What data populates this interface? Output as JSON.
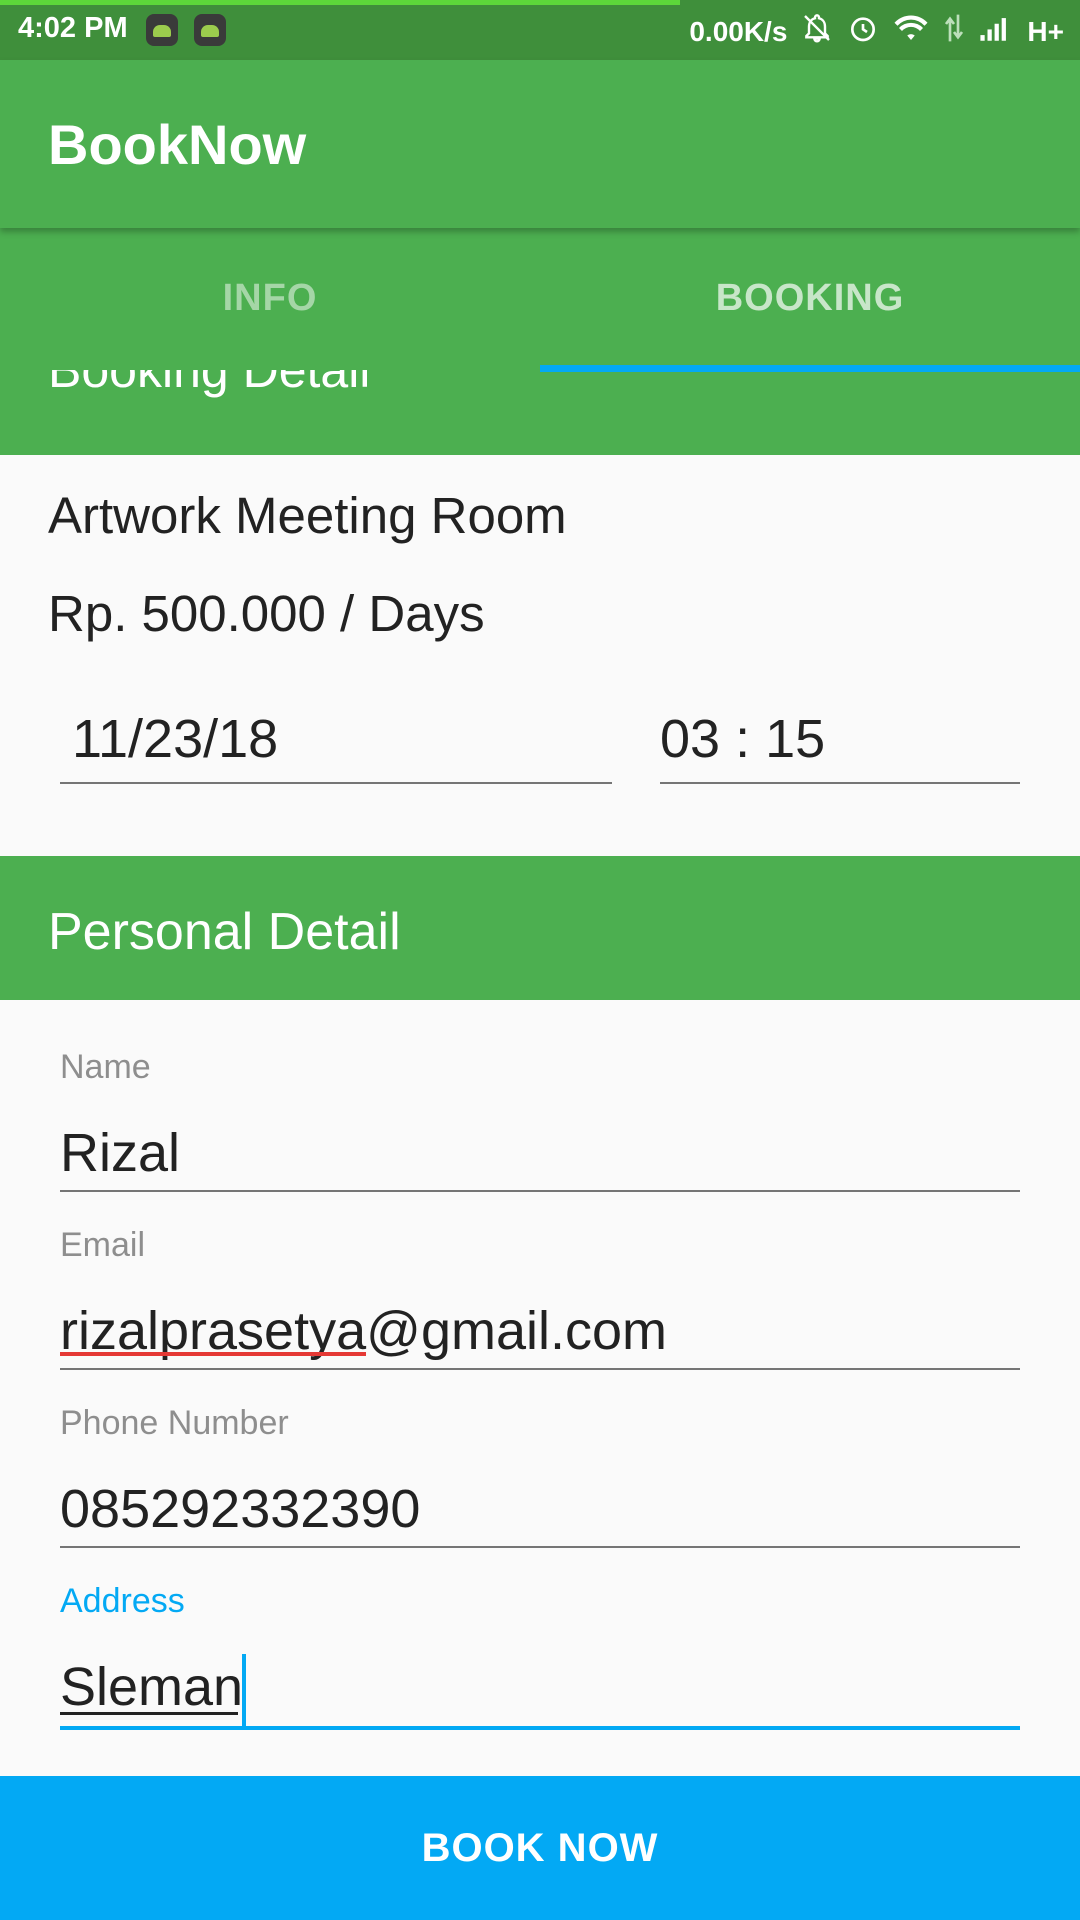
{
  "status_bar": {
    "time": "4:02 PM",
    "net_speed": "0.00K/s",
    "network_type": "H+",
    "icons": [
      "android-icon",
      "android-icon",
      "bell-off-icon",
      "alarm-icon",
      "wifi-icon",
      "data-arrows-icon",
      "signal-icon"
    ]
  },
  "app_bar": {
    "title": "BookNow"
  },
  "tabs": [
    {
      "label": "INFO",
      "selected": false
    },
    {
      "label": "BOOKING",
      "selected": true
    }
  ],
  "booking_detail": {
    "header": "Booking Detail",
    "room_name": "Artwork Meeting Room",
    "price": "Rp. 500.000 / Days",
    "date": "11/23/18",
    "time": "03 : 15"
  },
  "personal_detail": {
    "header": "Personal Detail",
    "name": {
      "label": "Name",
      "value": "Rizal"
    },
    "email": {
      "label": "Email",
      "value": "rizalprasetya@gmail.com"
    },
    "phone": {
      "label": "Phone Number",
      "value": "085292332390"
    },
    "address": {
      "label": "Address",
      "value": "Sleman"
    }
  },
  "actions": {
    "book_label": "BOOK NOW"
  },
  "colors": {
    "primary": "#4caf50",
    "primary_dark": "#3f8f3b",
    "accent": "#03a9f4",
    "error_underline": "#e53935"
  }
}
